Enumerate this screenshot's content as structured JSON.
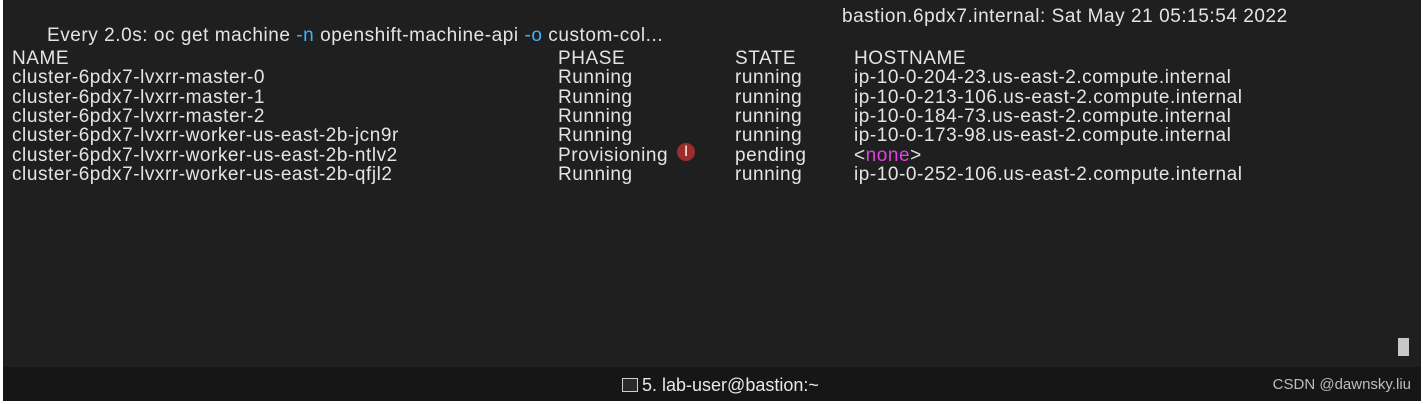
{
  "header": {
    "command_prefix": "Every 2.0s: oc get machine ",
    "flag_n": "-n",
    "namespace": " openshift-machine-api ",
    "flag_o": "-o",
    "command_rest": " custom-col...",
    "host_info": "bastion.6pdx7.internal: Sat May 21 05:15:54 2022"
  },
  "table": {
    "columns": [
      "NAME",
      "PHASE",
      "STATE",
      "HOSTNAME"
    ],
    "rows": [
      {
        "name": "cluster-6pdx7-lvxrr-master-0",
        "phase": "Running",
        "state": "running",
        "hostname": "ip-10-0-204-23.us-east-2.compute.internal"
      },
      {
        "name": "cluster-6pdx7-lvxrr-master-1",
        "phase": "Running",
        "state": "running",
        "hostname": "ip-10-0-213-106.us-east-2.compute.internal"
      },
      {
        "name": "cluster-6pdx7-lvxrr-master-2",
        "phase": "Running",
        "state": "running",
        "hostname": "ip-10-0-184-73.us-east-2.compute.internal"
      },
      {
        "name": "cluster-6pdx7-lvxrr-worker-us-east-2b-jcn9r",
        "phase": "Running",
        "state": "running",
        "hostname": "ip-10-0-173-98.us-east-2.compute.internal"
      },
      {
        "name": "cluster-6pdx7-lvxrr-worker-us-east-2b-ntlv2",
        "phase": "Provisioning",
        "state": "pending",
        "hostname_lt": "<",
        "hostname_none": "none",
        "hostname_gt": ">"
      },
      {
        "name": "cluster-6pdx7-lvxrr-worker-us-east-2b-qfjl2",
        "phase": "Running",
        "state": "running",
        "hostname": "ip-10-0-252-106.us-east-2.compute.internal"
      }
    ]
  },
  "statusbar": {
    "tab_label": "5. lab-user@bastion:~",
    "watermark": "CSDN @dawnsky.liu"
  },
  "colors": {
    "background": "#1f1f1f",
    "text": "#e4e4e4",
    "flag": "#3fb0ff",
    "none_value": "#e040e0"
  }
}
